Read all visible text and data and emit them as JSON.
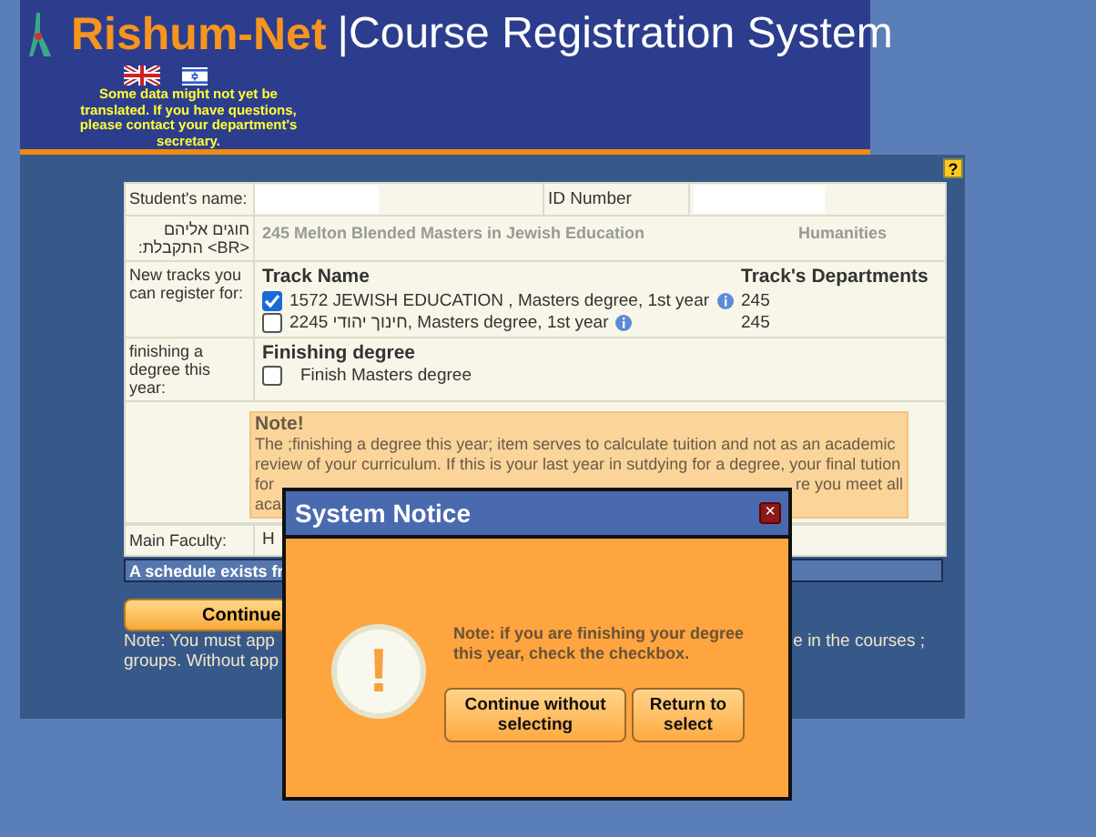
{
  "header": {
    "brand": "Rishum-Net",
    "title": "|Course Registration System",
    "translation_note": "Some data might not yet be translated. If you have questions, please contact your department's secretary."
  },
  "help_button": {
    "label": "?"
  },
  "form": {
    "student_name_label": "Student's name:",
    "id_label": "ID Number",
    "program_label": "חוגים אליהם <BR> התקבלת:",
    "program_name": "245 Melton Blended Masters in Jewish Education",
    "program_faculty": "Humanities",
    "tracks_label": "New tracks you can register for:",
    "track_name_header": "Track Name",
    "track_dept_header": "Track's Departments",
    "tracks": [
      {
        "name": "1572 JEWISH EDUCATION , Masters degree, 1st year",
        "department": "245",
        "checked": true
      },
      {
        "name": "2245 חינוך יהודי, Masters degree, 1st year",
        "department": "245",
        "checked": false
      }
    ],
    "finishing_label": "finishing a degree this year:",
    "finishing_header": "Finishing degree",
    "finishing_option": {
      "label": "Finish Masters degree",
      "checked": false
    },
    "note_title": "Note!",
    "note_lines": [
      "The ;finishing a degree this year; item serves to calculate tuition and not as an academic",
      "review of your curriculum. If this is your last year in sutdying for a degree, your final tution"
    ],
    "note_fragments": [
      [
        "for",
        "re you meet all"
      ],
      [
        "aca"
      ]
    ],
    "faculty_label": "Main Faculty:",
    "faculty_value": "H"
  },
  "schedule_bar": "A schedule exists fr",
  "continue_button": "Continue",
  "footer_note": [
    [
      "Note: You must app",
      "e in the courses ;"
    ],
    [
      "groups. Without app"
    ]
  ],
  "dialog": {
    "title": "System Notice",
    "close": "×",
    "message": "Note: if you are finishing your degree this year, check the checkbox.",
    "icon_mark": "!",
    "buttons": [
      "Continue without selecting",
      "Return to select"
    ]
  }
}
